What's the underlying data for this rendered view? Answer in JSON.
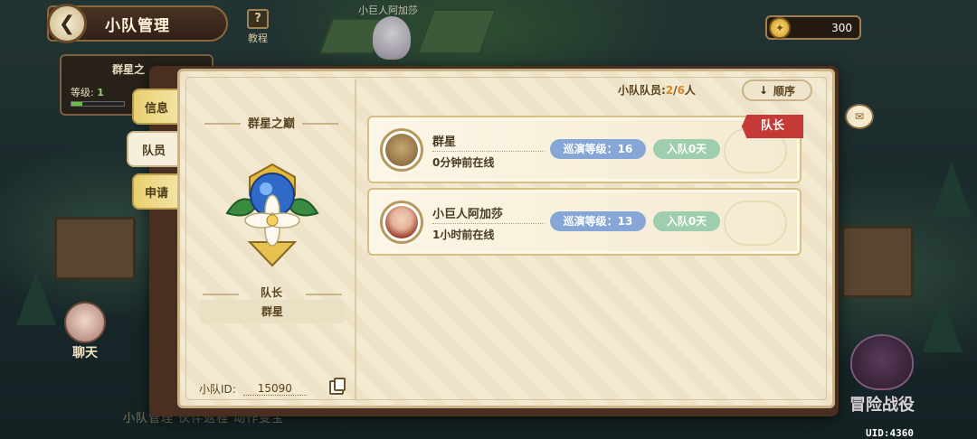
{
  "header": {
    "title": "小队管理",
    "tutorial_label": "教程",
    "npc_label": "小巨人阿加莎",
    "currency_value": "300"
  },
  "background": {
    "card_name": "群星之",
    "card_level_label": "等级:",
    "card_level_value": "1",
    "chat_label": "聊天",
    "bottom_strip_text": "小队管理  伙伴返程  动作变宝",
    "adventure_label": "冒险战役",
    "uid": "UID:4360"
  },
  "tabs": [
    {
      "label": "信息",
      "active": false
    },
    {
      "label": "队员",
      "active": true
    },
    {
      "label": "申请",
      "active": false
    }
  ],
  "team": {
    "name": "群星之巅",
    "leader_label": "队长",
    "leader_name": "群星",
    "id_label": "小队ID:",
    "id_value": "15090"
  },
  "members_header": {
    "count_label": "小队队员:",
    "count_current": "2",
    "count_separator": "/",
    "count_total": "6",
    "count_unit": "人",
    "sort_label": "顺序"
  },
  "members": [
    {
      "name": "群星",
      "status": "0分钟前在线",
      "level_text": "巡演等级：16",
      "days_text": "入队0天",
      "badge": "队长"
    },
    {
      "name": "小巨人阿加莎",
      "status": "1小时前在线",
      "level_text": "巡演等级：13",
      "days_text": "入队0天",
      "badge": ""
    }
  ],
  "colors": {
    "panel_bg": "#f2e8d0",
    "accent_orange": "#d9862a",
    "leader_red": "#c53a36",
    "pill_blue": "#86a7d6",
    "pill_green": "#9fceae"
  }
}
